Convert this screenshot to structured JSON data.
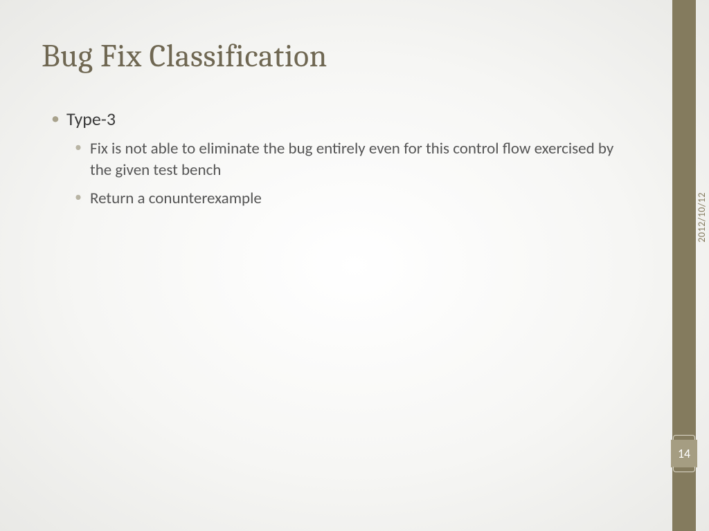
{
  "slide": {
    "title": "Bug Fix Classification",
    "bullets": {
      "level1": "Type-3",
      "level2a": "Fix is not able to eliminate the bug entirely even for this control flow exercised by the given test bench",
      "level2b": "Return a conunterexample"
    }
  },
  "sidebar": {
    "date": "2012/10/12",
    "pageNumber": "14"
  }
}
